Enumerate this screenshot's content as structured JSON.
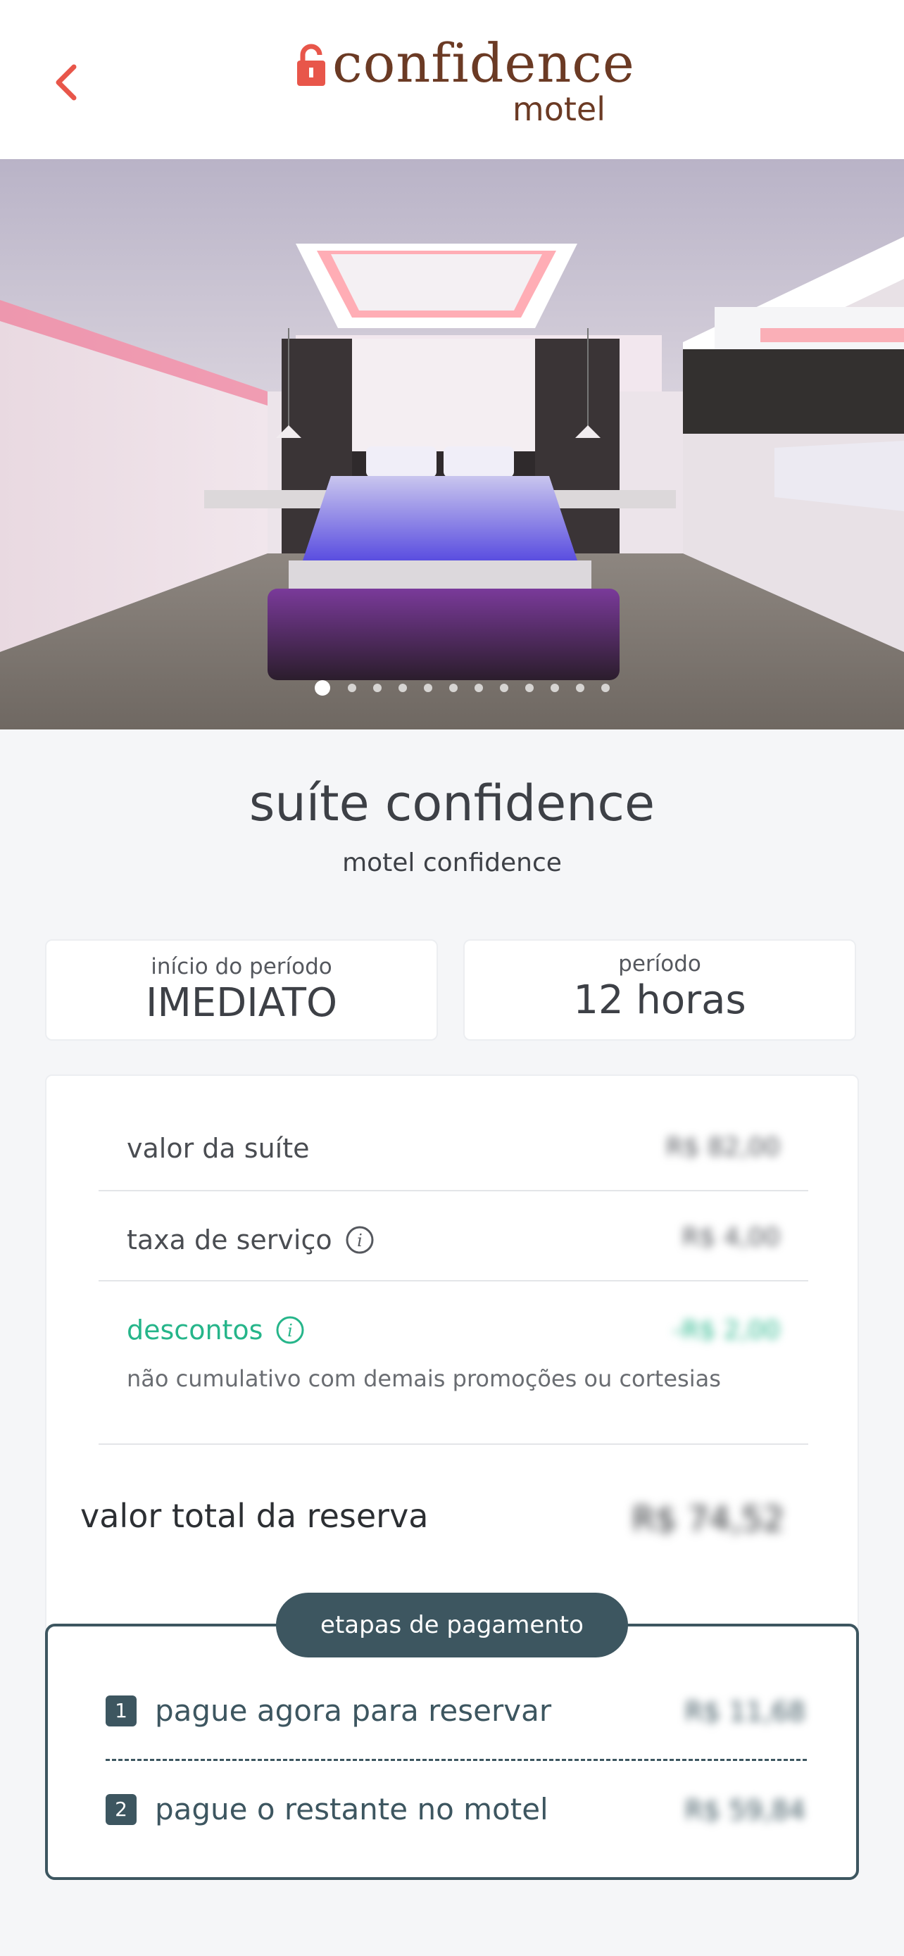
{
  "header": {
    "back_icon": "chevron-left-icon",
    "logo": {
      "word": "confidence",
      "sub": "motel"
    },
    "accent": "#e8564a",
    "brand_brown": "#6b3a24"
  },
  "hero": {
    "image_alt": "suite photo",
    "carousel_total": 12,
    "carousel_active": 1
  },
  "suite": {
    "title": "suíte confidence",
    "subtitle": "motel confidence"
  },
  "period": {
    "start_label": "início do período",
    "start_value": "IMEDIATO",
    "duration_label": "período",
    "duration_value": "12 horas"
  },
  "pricing": {
    "suite_label": "valor da suíte",
    "suite_value": "R$ 82,00",
    "fee_label": "taxa de serviço",
    "fee_value": "R$ 4,00",
    "discount_label": "descontos",
    "discount_value": "-R$ 2,00",
    "discount_note": "não cumulativo com demais promoções ou cortesias",
    "total_label": "valor total da reserva",
    "total_value": "R$ 74,52"
  },
  "payment_steps": {
    "title": "etapas de pagamento",
    "step1_num": "1",
    "step1_label": "pague agora para reservar",
    "step1_value": "R$ 11,68",
    "step2_num": "2",
    "step2_label": "pague o restante no motel",
    "step2_value": "R$ 59,84"
  },
  "colors": {
    "green": "#26b58a",
    "slate": "#3d5660"
  }
}
